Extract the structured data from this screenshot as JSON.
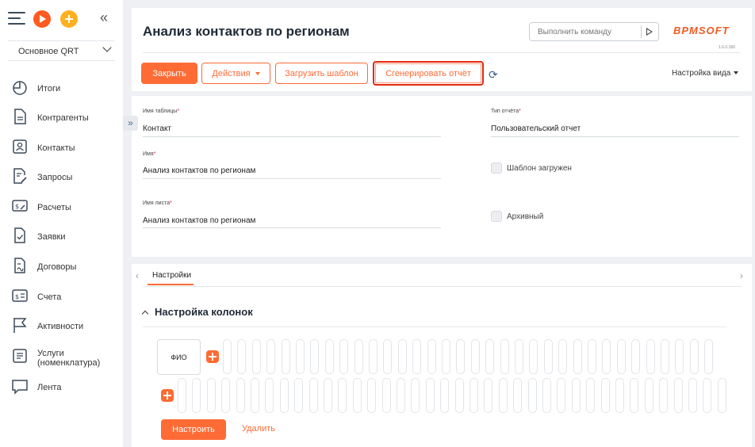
{
  "sidebar": {
    "workspace": "Основное QRT",
    "items": [
      {
        "label": "Итоги",
        "icon": "pie-chart-icon"
      },
      {
        "label": "Контрагенты",
        "icon": "document-icon"
      },
      {
        "label": "Контакты",
        "icon": "contact-card-icon"
      },
      {
        "label": "Запросы",
        "icon": "edit-document-icon"
      },
      {
        "label": "Расчеты",
        "icon": "money-icon"
      },
      {
        "label": "Заявки",
        "icon": "checklist-icon"
      },
      {
        "label": "Договоры",
        "icon": "contract-icon"
      },
      {
        "label": "Счета",
        "icon": "invoice-icon"
      },
      {
        "label": "Активности",
        "icon": "flag-icon"
      },
      {
        "label": "Услуги (номенклатура)",
        "icon": "list-icon"
      },
      {
        "label": "Лента",
        "icon": "chat-icon"
      }
    ]
  },
  "header": {
    "title": "Анализ контактов по регионам",
    "command_placeholder": "Выполнить команду",
    "logo": "BPMSOFT",
    "version": "1.6.0.180",
    "buttons": {
      "close": "Закрыть",
      "actions": "Действия",
      "load_template": "Загрузить шаблон",
      "generate": "Сгенерировать отчёт"
    },
    "view_settings": "Настройка вида"
  },
  "form": {
    "table_name_label": "Имя таблицы",
    "table_name_value": "Контакт",
    "report_type_label": "Тип отчёта",
    "report_type_value": "Пользовательский отчет",
    "name_label": "Имя",
    "name_value": "Анализ контактов по регионам",
    "template_loaded_label": "Шаблон загружен",
    "sheet_name_label": "Имя листа",
    "sheet_name_value": "Анализ контактов по регионам",
    "archived_label": "Архивный"
  },
  "tabs": {
    "active": "Настройки"
  },
  "columns_section": {
    "title": "Настройка колонок",
    "column": "ФИО",
    "configure": "Настроить",
    "delete": "Удалить"
  },
  "colors": {
    "accent": "#ff6b35",
    "highlight": "#e12a10"
  }
}
